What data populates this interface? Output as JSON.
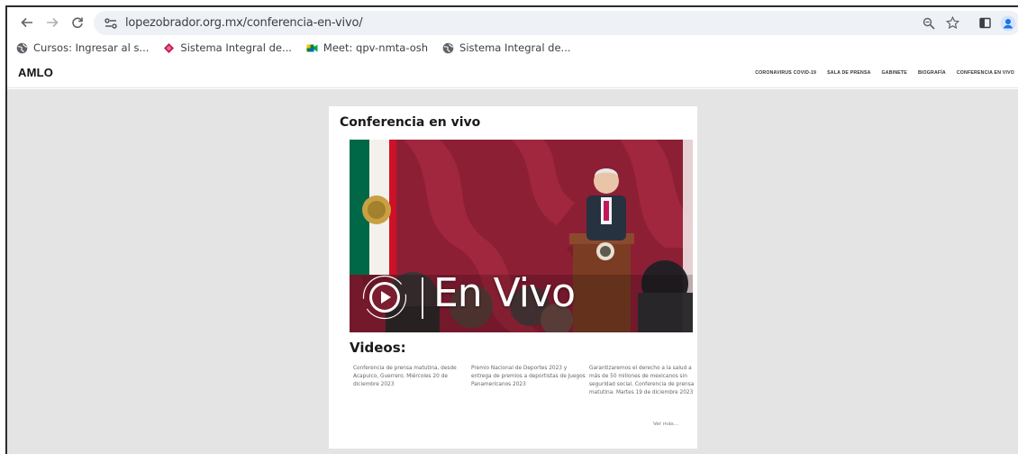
{
  "browser": {
    "url": "lopezobrador.org.mx/conferencia-en-vivo/",
    "bookmarks": [
      {
        "label": "Cursos: Ingresar al s...",
        "icon": "globe-icon"
      },
      {
        "label": "Sistema Integral de...",
        "icon": "diamond-icon"
      },
      {
        "label": "Meet: qpv-nmta-osh",
        "icon": "meet-icon"
      },
      {
        "label": "Sistema Integral de...",
        "icon": "globe-icon"
      }
    ]
  },
  "site": {
    "logo": "AMLO",
    "nav": [
      "CORONAVIRUS COVID-19",
      "SALA DE PRENSA",
      "GABINETE",
      "BIOGRAFÍA",
      "CONFERENCIA EN VIVO"
    ]
  },
  "main": {
    "title": "Conferencia en vivo",
    "hero_text": "En Vivo",
    "videos_title": "Videos:",
    "videos": [
      "Conferencia de prensa matutina, desde Acapulco, Guerrero. Miércoles 20 de diciembre 2023",
      "Premio Nacional de Deportes 2023 y entrega de premios a deportistas de Juegos Panamericanos 2023",
      "Garantizaremos el derecho a la salud a más de 50 millones de mexicanos sin seguridad social. Conferencia de prensa matutina. Martes 19 de diciembre 2023"
    ],
    "more_link": "Ver más..."
  },
  "colors": {
    "page_bg": "#e4e4e4",
    "hero_red": "#8d1f35",
    "omnibox_bg": "#eef1f6",
    "profile_blue": "#1a73e8"
  }
}
